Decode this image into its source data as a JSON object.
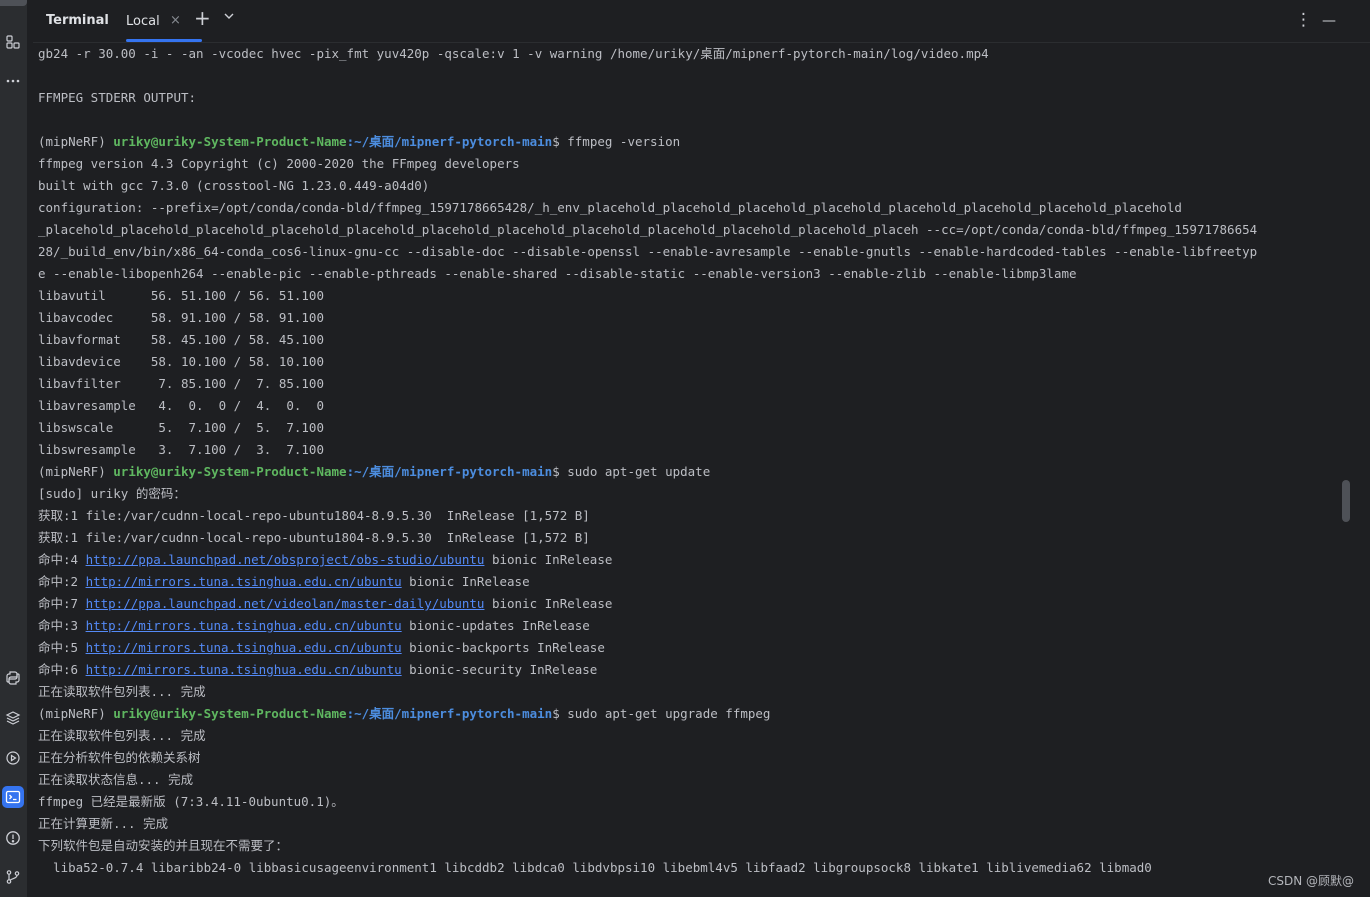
{
  "tabbar": {
    "title": "Terminal",
    "tab_local": "Local",
    "close_glyph": "×",
    "add_glyph": "+",
    "dropdown_glyph": "⌄",
    "more_glyph": "⋮",
    "minimize_glyph": "—"
  },
  "rail": {
    "icons": [
      "structure-icon",
      "more-icon",
      "python-console-icon",
      "layers-icon",
      "services-icon",
      "terminal-icon",
      "problems-icon",
      "git-icon"
    ]
  },
  "prompt": {
    "env": "(mipNeRF) ",
    "user": "uriky@uriky-System-Product-Name",
    "path": ":~/桌面/mipnerf-pytorch-main",
    "sep": "$ "
  },
  "lines": [
    {
      "t": "text",
      "v": "gb24 -r 30.00 -i - -an -vcodec hvec -pix_fmt yuv420p -qscale:v 1 -v warning /home/uriky/桌面/mipnerf-pytorch-main/log/video.mp4"
    },
    {
      "t": "text",
      "v": ""
    },
    {
      "t": "text",
      "v": "FFMPEG STDERR OUTPUT:"
    },
    {
      "t": "text",
      "v": ""
    },
    {
      "t": "prompt",
      "cmd": "ffmpeg -version"
    },
    {
      "t": "text",
      "v": "ffmpeg version 4.3 Copyright (c) 2000-2020 the FFmpeg developers"
    },
    {
      "t": "text",
      "v": "built with gcc 7.3.0 (crosstool-NG 1.23.0.449-a04d0)"
    },
    {
      "t": "text",
      "v": "configuration: --prefix=/opt/conda/conda-bld/ffmpeg_1597178665428/_h_env_placehold_placehold_placehold_placehold_placehold_placehold_placehold_placehold"
    },
    {
      "t": "text",
      "v": "_placehold_placehold_placehold_placehold_placehold_placehold_placehold_placehold_placehold_placehold_placehold_placeh --cc=/opt/conda/conda-bld/ffmpeg_15971786654"
    },
    {
      "t": "text",
      "v": "28/_build_env/bin/x86_64-conda_cos6-linux-gnu-cc --disable-doc --disable-openssl --enable-avresample --enable-gnutls --enable-hardcoded-tables --enable-libfreetyp"
    },
    {
      "t": "text",
      "v": "e --enable-libopenh264 --enable-pic --enable-pthreads --enable-shared --disable-static --enable-version3 --enable-zlib --enable-libmp3lame"
    },
    {
      "t": "text",
      "v": "libavutil      56. 51.100 / 56. 51.100"
    },
    {
      "t": "text",
      "v": "libavcodec     58. 91.100 / 58. 91.100"
    },
    {
      "t": "text",
      "v": "libavformat    58. 45.100 / 58. 45.100"
    },
    {
      "t": "text",
      "v": "libavdevice    58. 10.100 / 58. 10.100"
    },
    {
      "t": "text",
      "v": "libavfilter     7. 85.100 /  7. 85.100"
    },
    {
      "t": "text",
      "v": "libavresample   4.  0.  0 /  4.  0.  0"
    },
    {
      "t": "text",
      "v": "libswscale      5.  7.100 /  5.  7.100"
    },
    {
      "t": "text",
      "v": "libswresample   3.  7.100 /  3.  7.100"
    },
    {
      "t": "prompt",
      "cmd": "sudo apt-get update"
    },
    {
      "t": "text",
      "v": "[sudo] uriky 的密码："
    },
    {
      "t": "text",
      "v": "获取:1 file:/var/cudnn-local-repo-ubuntu1804-8.9.5.30  InRelease [1,572 B]"
    },
    {
      "t": "text",
      "v": "获取:1 file:/var/cudnn-local-repo-ubuntu1804-8.9.5.30  InRelease [1,572 B]"
    },
    {
      "t": "link",
      "pre": "命中:4 ",
      "url": "http://ppa.launchpad.net/obsproject/obs-studio/ubuntu",
      "post": " bionic InRelease"
    },
    {
      "t": "link",
      "pre": "命中:2 ",
      "url": "http://mirrors.tuna.tsinghua.edu.cn/ubuntu",
      "post": " bionic InRelease"
    },
    {
      "t": "link",
      "pre": "命中:7 ",
      "url": "http://ppa.launchpad.net/videolan/master-daily/ubuntu",
      "post": " bionic InRelease"
    },
    {
      "t": "link",
      "pre": "命中:3 ",
      "url": "http://mirrors.tuna.tsinghua.edu.cn/ubuntu",
      "post": " bionic-updates InRelease"
    },
    {
      "t": "link",
      "pre": "命中:5 ",
      "url": "http://mirrors.tuna.tsinghua.edu.cn/ubuntu",
      "post": " bionic-backports InRelease"
    },
    {
      "t": "link",
      "pre": "命中:6 ",
      "url": "http://mirrors.tuna.tsinghua.edu.cn/ubuntu",
      "post": " bionic-security InRelease"
    },
    {
      "t": "text",
      "v": "正在读取软件包列表... 完成"
    },
    {
      "t": "prompt",
      "cmd": "sudo apt-get upgrade ffmpeg"
    },
    {
      "t": "text",
      "v": "正在读取软件包列表... 完成"
    },
    {
      "t": "text",
      "v": "正在分析软件包的依赖关系树"
    },
    {
      "t": "text",
      "v": "正在读取状态信息... 完成"
    },
    {
      "t": "text",
      "v": "ffmpeg 已经是最新版 (7:3.4.11-0ubuntu0.1)。"
    },
    {
      "t": "text",
      "v": "正在计算更新... 完成"
    },
    {
      "t": "text",
      "v": "下列软件包是自动安装的并且现在不需要了："
    },
    {
      "t": "text",
      "v": "  liba52-0.7.4 libaribb24-0 libbasicusageenvironment1 libcddb2 libdca0 libdvbpsi10 libebml4v5 libfaad2 libgroupsock8 libkate1 liblivemedia62 libmad0"
    }
  ],
  "watermark": "CSDN @顾默@"
}
